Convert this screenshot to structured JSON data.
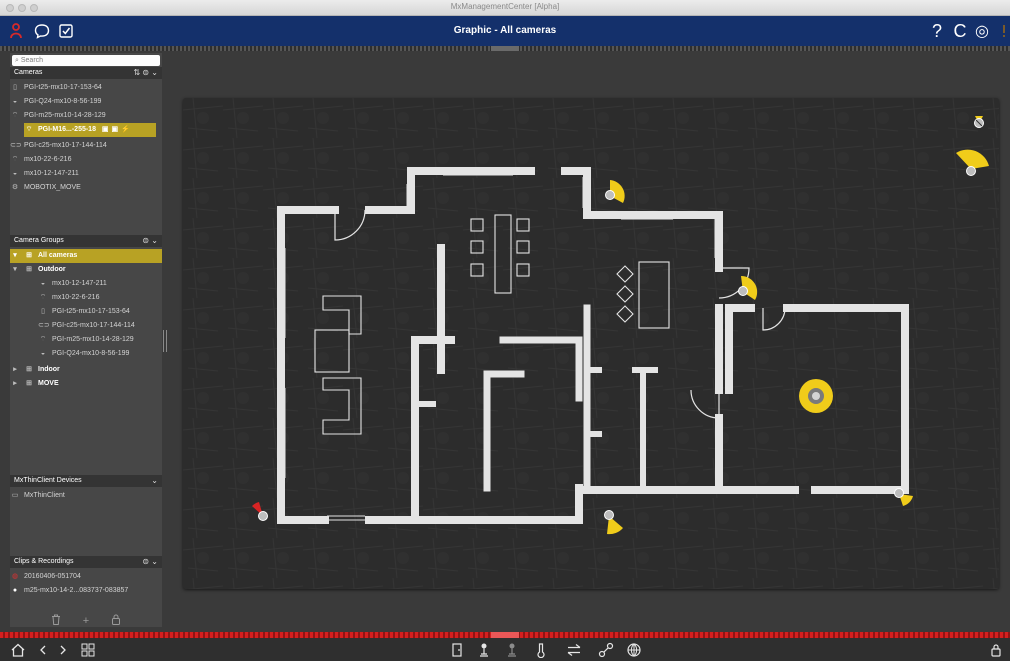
{
  "window": {
    "title": "MxManagementCenter [Alpha]"
  },
  "toolbar": {
    "title": "Graphic - All cameras",
    "left_icons": [
      "users-icon",
      "chat-bubble-icon",
      "checklist-icon"
    ],
    "right_icons": [
      "help-icon",
      "refresh-icon",
      "settings-icon",
      "info-icon"
    ],
    "help_glyph": "?",
    "refresh_glyph": "C",
    "settings_glyph": "◎"
  },
  "sidebar": {
    "search_placeholder": "Search",
    "cameras": {
      "header": "Cameras",
      "tools": "⇅ ⊜ ⌄",
      "items": [
        {
          "label": "PGI-t25-mx10-17-153-64",
          "icon": "camera-t25-icon"
        },
        {
          "label": "PGI-Q24-mx10-8-56-199",
          "icon": "camera-q24-icon"
        },
        {
          "label": "PGI-m25-mx10-14-28-129",
          "icon": "camera-m25-icon"
        },
        {
          "label": "PGI-M16...-255-18",
          "icon": "camera-m16-icon",
          "selected": true
        },
        {
          "label": "PGI-c25-mx10-17-144-114",
          "icon": "camera-c25-icon"
        },
        {
          "label": "mx10-22-6-216",
          "icon": "camera-m25-icon"
        },
        {
          "label": "mx10-12-147-211",
          "icon": "camera-q24-icon"
        },
        {
          "label": "MOBOTIX_MOVE",
          "icon": "camera-move-icon"
        }
      ]
    },
    "groups": {
      "header": "Camera Groups",
      "tools": "⊜ ⌄",
      "items": [
        {
          "label": "All cameras",
          "selected": true,
          "level": 0,
          "arrow": "▾"
        },
        {
          "label": "Outdoor",
          "level": 0,
          "group": true,
          "arrow": "▾"
        },
        {
          "label": "mx10-12-147-211",
          "level": 1
        },
        {
          "label": "mx10-22-6-216",
          "level": 1
        },
        {
          "label": "PGI-t25-mx10-17-153-64",
          "level": 1
        },
        {
          "label": "PGI-c25-mx10-17-144-114",
          "level": 1
        },
        {
          "label": "PGI-m25-mx10-14-28-129",
          "level": 1
        },
        {
          "label": "PGI-Q24-mx10-8-56-199",
          "level": 1
        },
        {
          "label": "Indoor",
          "level": 0,
          "group": true,
          "arrow": "▸"
        },
        {
          "label": "MOVE",
          "level": 0,
          "group": true,
          "arrow": "▸"
        }
      ]
    },
    "thin_clients": {
      "header": "MxThinClient Devices",
      "tools": "⌄",
      "items": [
        {
          "label": "MxThinClient"
        }
      ]
    },
    "clips": {
      "header": "Clips & Recordings",
      "tools": "⊜ ⌄",
      "items": [
        {
          "label": "20160406-051704",
          "kind": "red"
        },
        {
          "label": "m25-mx10-14-2...083737-083857",
          "kind": "white"
        }
      ]
    },
    "bottom_tools": [
      "trash-icon",
      "add-icon",
      "lock-icon"
    ],
    "add_glyph": "+"
  },
  "status_bar": {
    "left_icons": [
      "home-icon",
      "back-icon",
      "forward-icon",
      "grid-view-icon"
    ],
    "center_icons": [
      "door-icon",
      "pin-icon",
      "pin-gray-icon",
      "temperature-icon",
      "transfer-icon",
      "link-icon",
      "globe-icon"
    ],
    "right_icon": "lock-icon"
  },
  "colors": {
    "accent": "#b8a224",
    "toolbar": "#14306b",
    "camera_yellow": "#f0cc1a",
    "alarm_red": "#d82424",
    "status_red": "#d41f1f"
  }
}
